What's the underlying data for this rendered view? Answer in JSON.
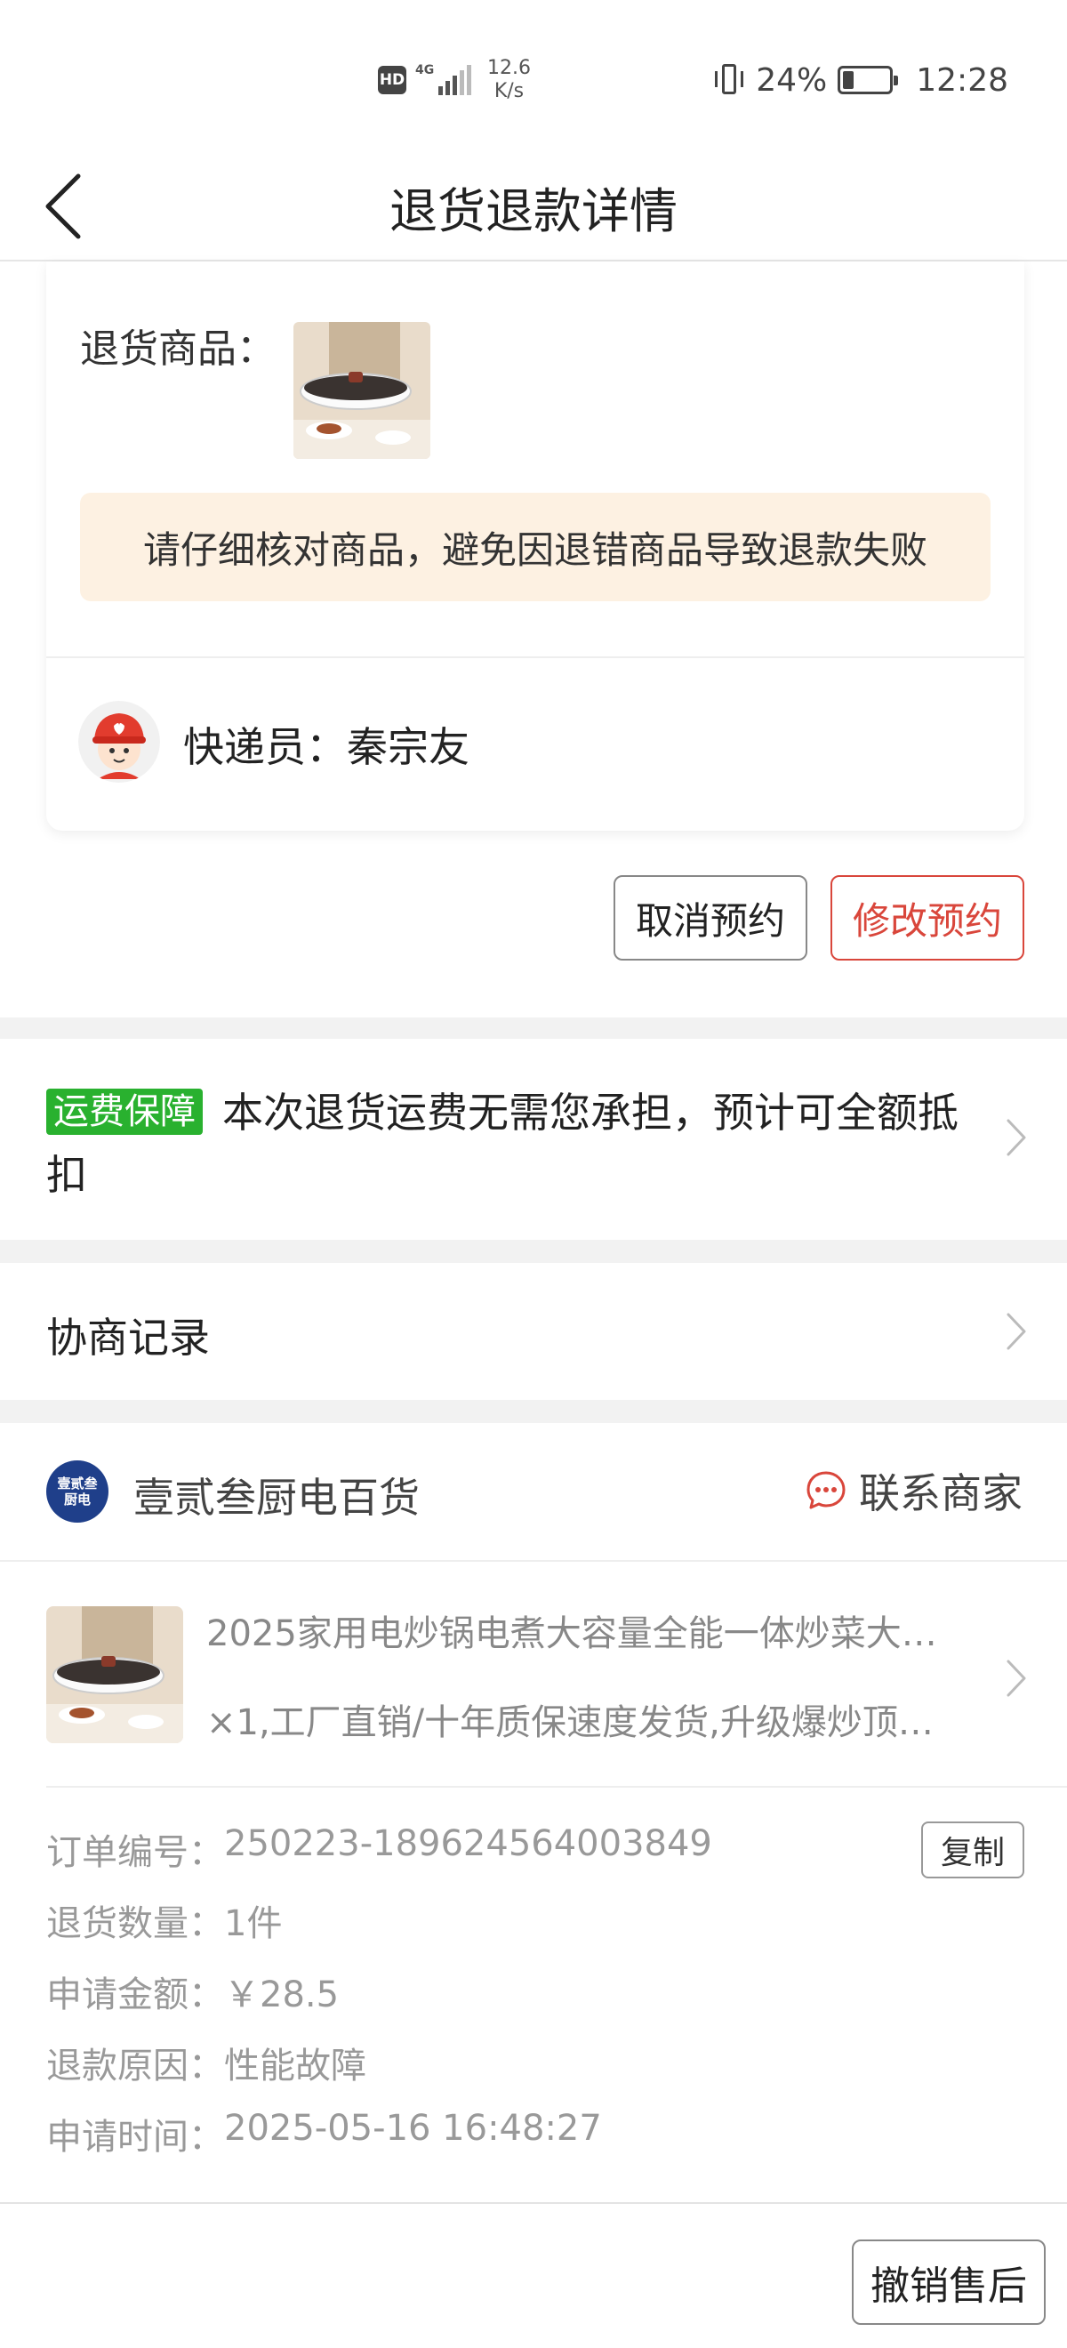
{
  "status_bar": {
    "hd": "HD",
    "network": "4G",
    "speed_value": "12.6",
    "speed_unit": "K/s",
    "battery": "24%",
    "time": "12:28",
    "battery_level": 0.24
  },
  "nav": {
    "title": "退货退款详情",
    "back_icon": "chevron-left-icon"
  },
  "return_card": {
    "goods_label": "退货商品：",
    "warning": "请仔细核对商品，避免因退错商品导致退款失败",
    "courier": "快递员：秦宗友"
  },
  "actions": {
    "cancel": "取消预约",
    "modify": "修改预约"
  },
  "shipping": {
    "tag": "运费保障",
    "text": "本次退货运费无需您承担，预计可全额抵扣"
  },
  "negotiation": {
    "label": "协商记录"
  },
  "store": {
    "logo_text": "壹贰叁厨电",
    "name": "壹贰叁厨电百货",
    "contact": "联系商家",
    "item_title": "2025家用电炒锅电煮大容量全能一体炒菜大…",
    "item_sub": "×1,工厂直销/十年质保速度发货,升级爆炒顶…",
    "copy": "复制",
    "info": [
      {
        "label": "订单编号：",
        "value": "250223-189624564003849"
      },
      {
        "label": "退货数量：",
        "value": "1件"
      },
      {
        "label": "申请金额：",
        "value": "￥28.5"
      },
      {
        "label": "退款原因：",
        "value": "性能故障"
      },
      {
        "label": "申请时间：",
        "value": "2025-05-16 16:48:27"
      }
    ]
  },
  "bottom": {
    "revoke": "撤销售后"
  },
  "colors": {
    "accent_red": "#d9463b",
    "tag_green": "#29b12f",
    "warning_bg": "#fdf1e2",
    "store_logo_bg": "#1f3f8a"
  }
}
